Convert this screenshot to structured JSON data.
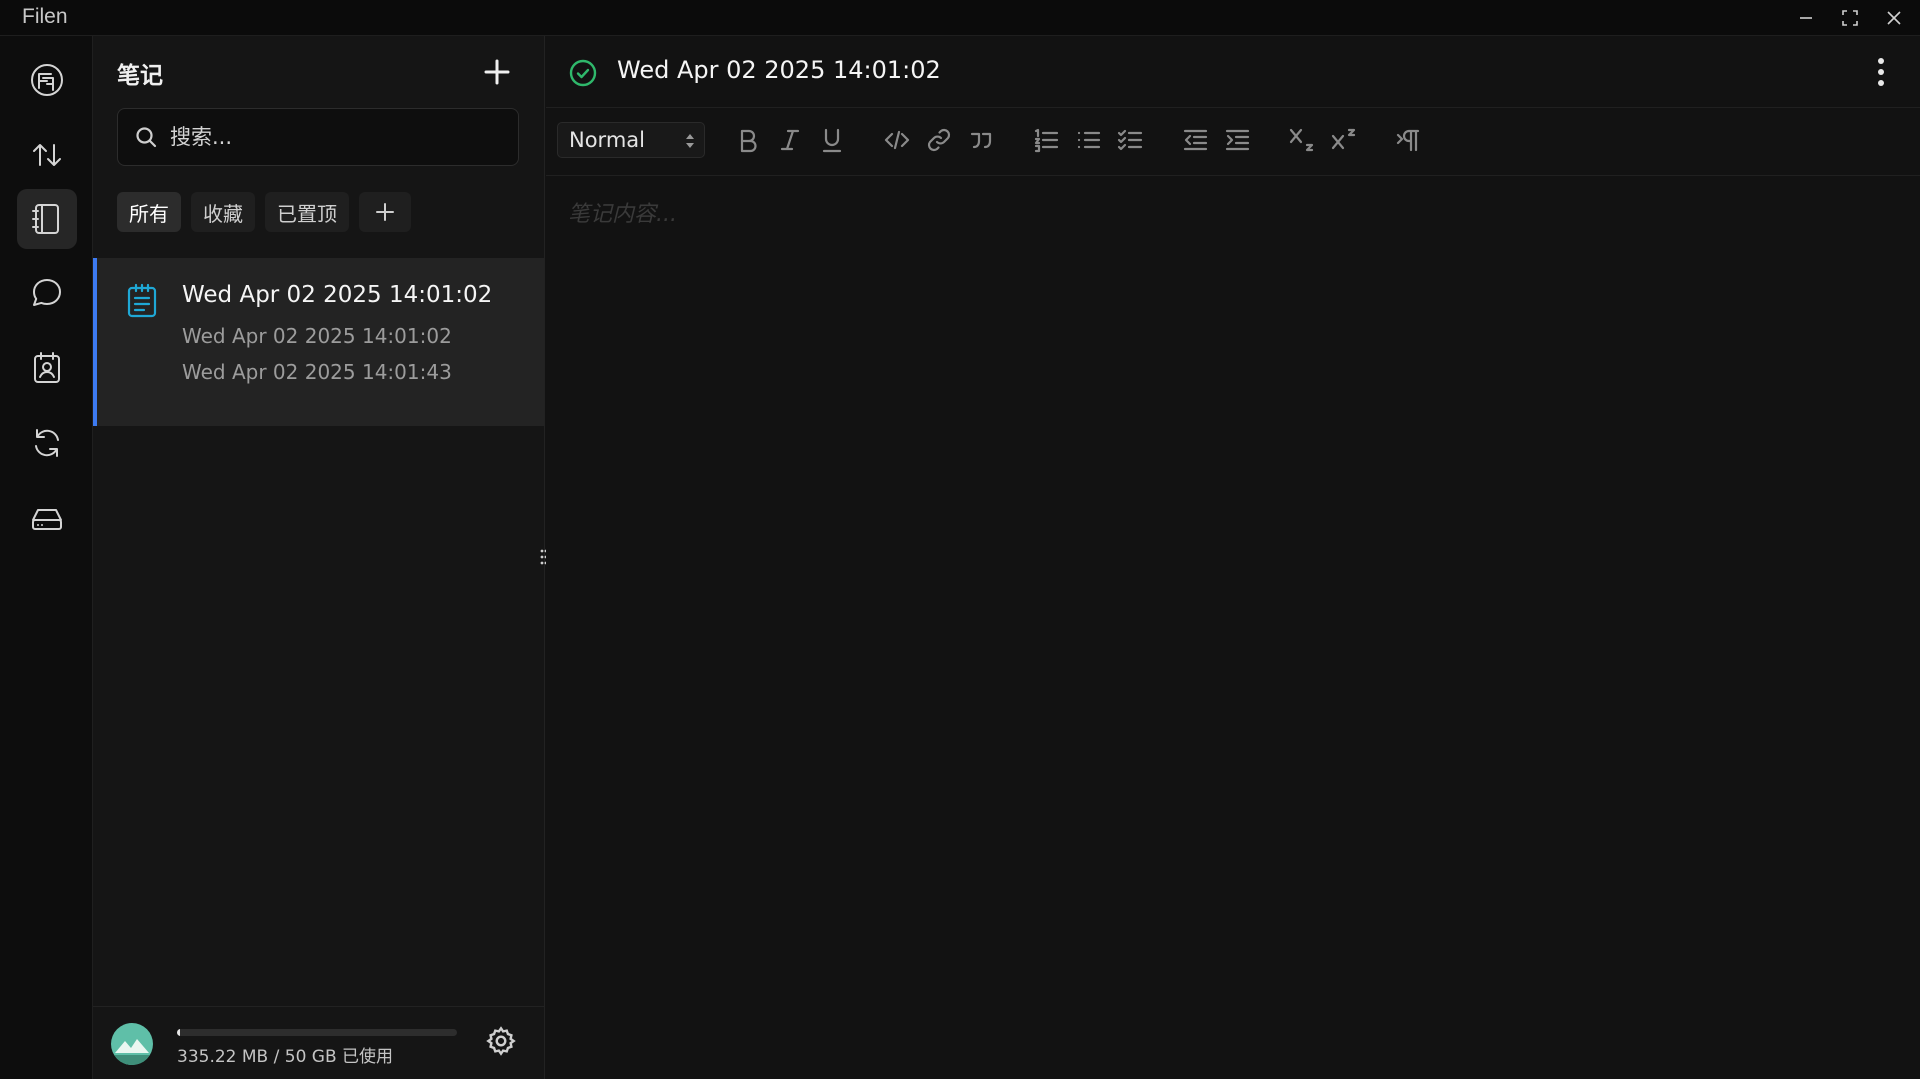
{
  "window": {
    "app_title": "Filen"
  },
  "sidebar": {
    "items": [
      {
        "id": "logo",
        "icon": "filen-logo-icon"
      },
      {
        "id": "transfers",
        "icon": "arrows-up-down-icon"
      },
      {
        "id": "notes",
        "icon": "notebook-icon",
        "active": true
      },
      {
        "id": "chats",
        "icon": "chat-bubble-icon"
      },
      {
        "id": "contacts",
        "icon": "contact-card-icon"
      },
      {
        "id": "sync",
        "icon": "refresh-icon"
      },
      {
        "id": "drives",
        "icon": "hard-drive-icon"
      }
    ]
  },
  "notes_panel": {
    "title": "笔记",
    "search_placeholder": "搜索...",
    "tags": {
      "all": "所有",
      "favorites": "收藏",
      "pinned": "已置顶"
    },
    "notes": [
      {
        "title": "Wed Apr 02 2025 14:01:02",
        "preview": "Wed Apr 02 2025 14:01:02",
        "timestamp": "Wed Apr 02 2025 14:01:43"
      }
    ],
    "storage": {
      "text": "335.22 MB / 50 GB 已使用",
      "used_fraction": 0.0067
    }
  },
  "editor": {
    "title": "Wed Apr 02 2025 14:01:02",
    "format_selected": "Normal",
    "content_placeholder": "笔记内容..."
  },
  "colors": {
    "accent": "#3d7bf2",
    "note_icon": "#1fa8d6",
    "saved": "#2fb86b"
  }
}
